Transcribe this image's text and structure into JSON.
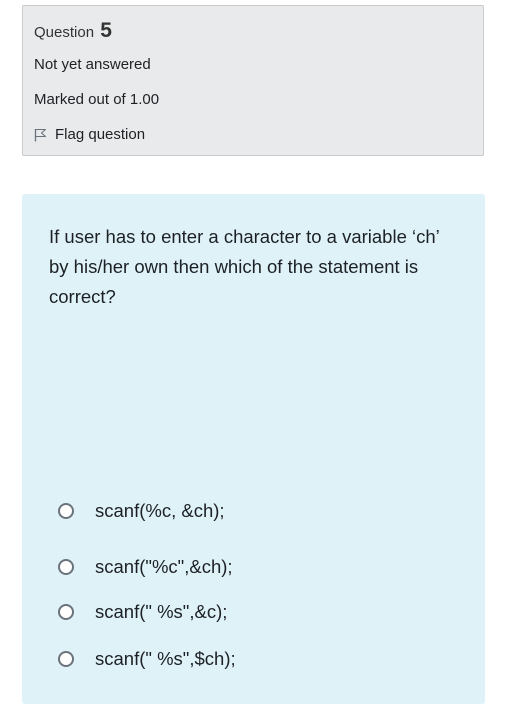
{
  "info": {
    "question_label": "Question",
    "question_number": "5",
    "state": "Not yet answered",
    "grade": "Marked out of 1.00",
    "flag_label": "Flag question"
  },
  "question": {
    "text": "If user has to enter a character to a variable ‘ch’ by his/her own then which of the statement is correct?",
    "options": [
      {
        "label": "scanf(%c, &ch);"
      },
      {
        "label": "scanf(\"%c\",&ch);"
      },
      {
        "label": "scanf(\" %s\",&c);"
      },
      {
        "label": "scanf(\" %s\",$ch);"
      }
    ]
  }
}
